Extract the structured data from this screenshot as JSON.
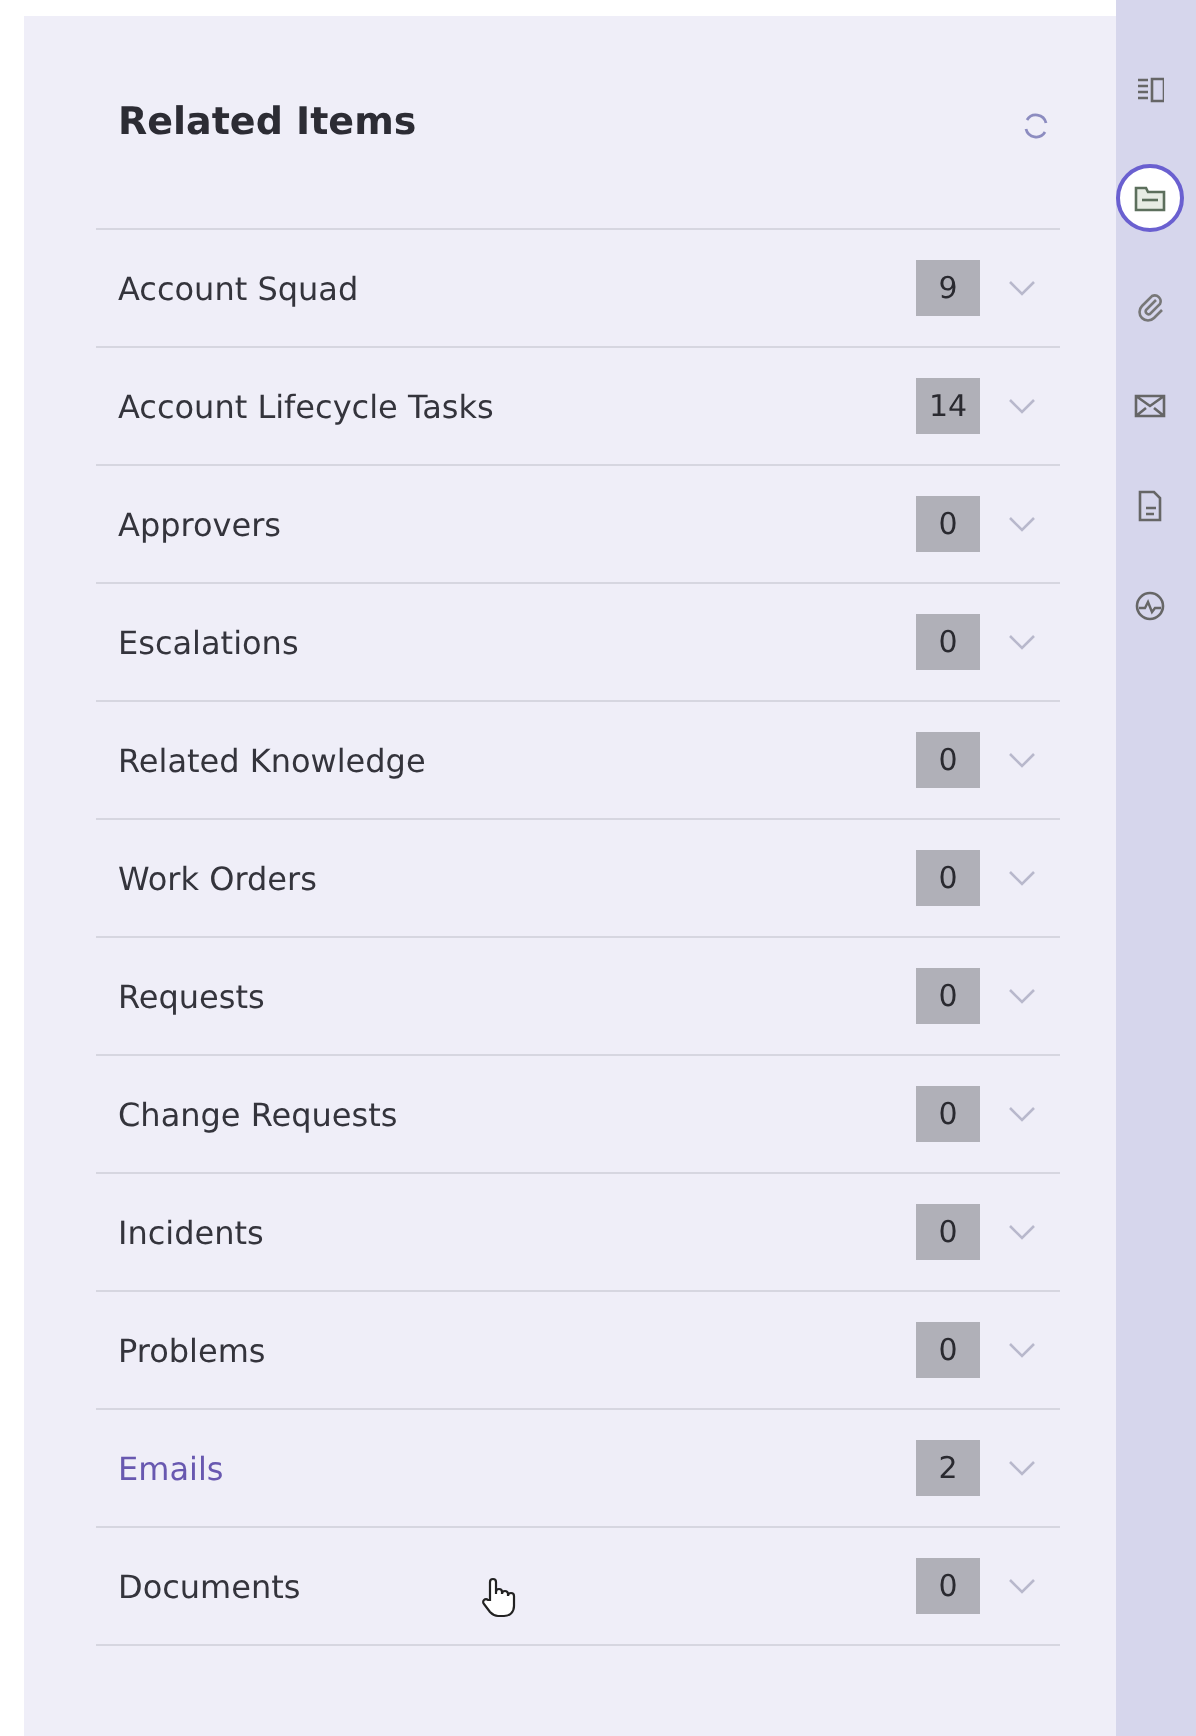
{
  "panel": {
    "title": "Related Items"
  },
  "items": [
    {
      "label": "Account Squad",
      "count": "9",
      "highlighted": false
    },
    {
      "label": "Account Lifecycle Tasks",
      "count": "14",
      "highlighted": false
    },
    {
      "label": "Approvers",
      "count": "0",
      "highlighted": false
    },
    {
      "label": "Escalations",
      "count": "0",
      "highlighted": false
    },
    {
      "label": "Related Knowledge",
      "count": "0",
      "highlighted": false
    },
    {
      "label": "Work Orders",
      "count": "0",
      "highlighted": false
    },
    {
      "label": "Requests",
      "count": "0",
      "highlighted": false
    },
    {
      "label": "Change Requests",
      "count": "0",
      "highlighted": false
    },
    {
      "label": "Incidents",
      "count": "0",
      "highlighted": false
    },
    {
      "label": "Problems",
      "count": "0",
      "highlighted": false
    },
    {
      "label": "Emails",
      "count": "2",
      "highlighted": true
    },
    {
      "label": "Documents",
      "count": "0",
      "highlighted": false
    }
  ],
  "sidebar": {
    "tabs": [
      {
        "kind": "details",
        "selected": false
      },
      {
        "kind": "related",
        "selected": true
      },
      {
        "kind": "attachments",
        "selected": false
      },
      {
        "kind": "email",
        "selected": false
      },
      {
        "kind": "document",
        "selected": false
      },
      {
        "kind": "activity",
        "selected": false
      }
    ]
  }
}
